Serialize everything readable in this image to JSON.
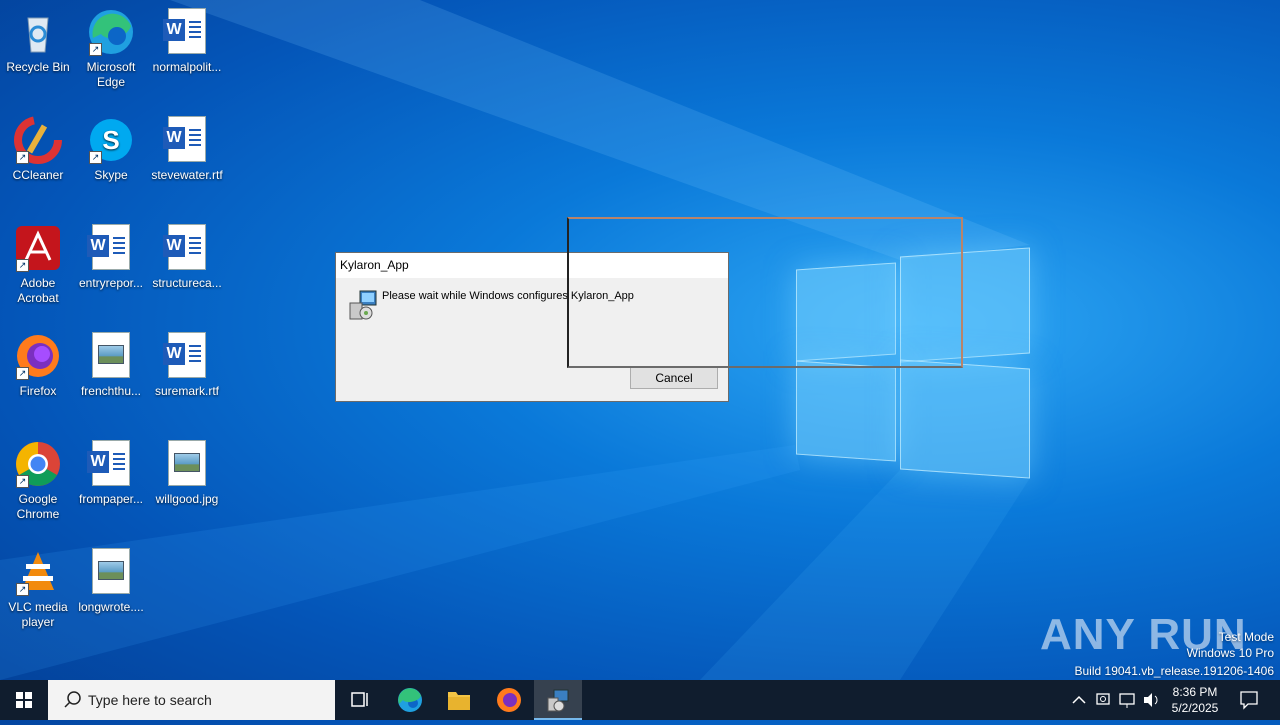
{
  "desktop": {
    "icons": [
      {
        "label": "Recycle Bin"
      },
      {
        "label": "Microsoft Edge"
      },
      {
        "label": "normalpolit..."
      },
      {
        "label": "CCleaner"
      },
      {
        "label": "Skype"
      },
      {
        "label": "stevewater.rtf"
      },
      {
        "label": "Adobe Acrobat"
      },
      {
        "label": "entryrepor..."
      },
      {
        "label": "structureca..."
      },
      {
        "label": "Firefox"
      },
      {
        "label": "frenchthu..."
      },
      {
        "label": "suremark.rtf"
      },
      {
        "label": "Google Chrome"
      },
      {
        "label": "frompaper..."
      },
      {
        "label": "willgood.jpg"
      },
      {
        "label": "VLC media player"
      },
      {
        "label": "longwrote...."
      }
    ]
  },
  "dialog": {
    "title": "Kylaron_App",
    "message": "Please wait while Windows configures Kylaron_App",
    "cancel_label": "Cancel"
  },
  "watermark": {
    "brand": "ANY RUN",
    "line1": "Test Mode",
    "line2": "Windows 10 Pro",
    "line3": "Build 19041.vb_release.191206-1406"
  },
  "taskbar": {
    "search_placeholder": "Type here to search",
    "time": "8:36 PM",
    "date": "5/2/2025"
  },
  "colors": {
    "taskbar": "#101d2e",
    "accent": "#76b9ed",
    "desktop": "#0a79d9"
  }
}
